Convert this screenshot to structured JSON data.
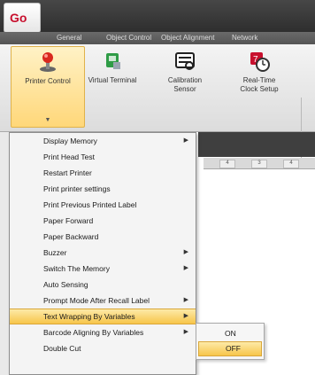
{
  "app": {
    "logo_text": "Go"
  },
  "ribbon_tabs": [
    "General",
    "Object Control",
    "Object Alignment",
    "Network"
  ],
  "ribbon_buttons": [
    {
      "label": "Printer Control",
      "icon": "printer-control-icon",
      "active": true
    },
    {
      "label": "Virtual Terminal",
      "icon": "virtual-terminal-icon",
      "active": false
    },
    {
      "label": "Calibration Sensor",
      "icon": "calibration-sensor-icon",
      "active": false
    },
    {
      "label": "Real-Time Clock Setup",
      "icon": "real-time-clock-icon",
      "active": false
    }
  ],
  "ruler_ticks": [
    "4",
    "3",
    "4"
  ],
  "menu": {
    "items": [
      {
        "label": "Display Memory",
        "submenu": true
      },
      {
        "label": "Print Head Test",
        "submenu": false
      },
      {
        "label": "Restart Printer",
        "submenu": false
      },
      {
        "label": "Print printer settings",
        "submenu": false
      },
      {
        "label": "Print Previous Printed Label",
        "submenu": false
      },
      {
        "label": "Paper Forward",
        "submenu": false
      },
      {
        "label": "Paper Backward",
        "submenu": false
      },
      {
        "label": "Buzzer",
        "submenu": true
      },
      {
        "label": "Switch The Memory",
        "submenu": true
      },
      {
        "label": "Auto Sensing",
        "submenu": false
      },
      {
        "label": "Prompt Mode After Recall Label",
        "submenu": true
      },
      {
        "label": "Text Wrapping By Variables",
        "submenu": true,
        "highlighted": true
      },
      {
        "label": "Barcode Aligning By Variables",
        "submenu": true
      },
      {
        "label": "Double Cut",
        "submenu": false
      }
    ]
  },
  "submenu": {
    "items": [
      {
        "label": "ON",
        "highlighted": false
      },
      {
        "label": "OFF",
        "highlighted": true
      }
    ]
  },
  "colors": {
    "highlight": "#f7c54a",
    "titlebar": "#2e2e2e"
  }
}
